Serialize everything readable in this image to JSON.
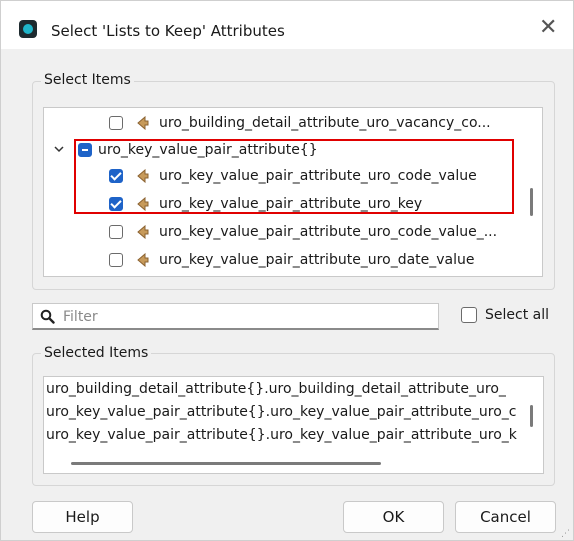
{
  "window": {
    "title": "Select 'Lists to Keep' Attributes",
    "close_glyph": "✕"
  },
  "select_items": {
    "group_label": "Select Items",
    "tree": [
      {
        "label": "uro_building_detail_attribute_uro_vacancy_co...",
        "checked": false,
        "kind": "attribute"
      },
      {
        "label": "uro_key_value_pair_attribute{}",
        "checked": "partial",
        "kind": "list",
        "expanded": true
      },
      {
        "label": "uro_key_value_pair_attribute_uro_code_value",
        "checked": true,
        "kind": "attribute"
      },
      {
        "label": "uro_key_value_pair_attribute_uro_key",
        "checked": true,
        "kind": "attribute"
      },
      {
        "label": "uro_key_value_pair_attribute_uro_code_value_...",
        "checked": false,
        "kind": "attribute"
      },
      {
        "label": "uro_key_value_pair_attribute_uro_date_value",
        "checked": false,
        "kind": "attribute"
      }
    ]
  },
  "filter": {
    "placeholder": "Filter"
  },
  "select_all": {
    "label": "Select all",
    "checked": false
  },
  "selected_items": {
    "group_label": "Selected Items",
    "lines": [
      "uro_building_detail_attribute{}.uro_building_detail_attribute_uro_",
      "uro_key_value_pair_attribute{}.uro_key_value_pair_attribute_uro_c",
      "uro_key_value_pair_attribute{}.uro_key_value_pair_attribute_uro_k"
    ]
  },
  "buttons": {
    "help": "Help",
    "ok": "OK",
    "cancel": "Cancel"
  },
  "colors": {
    "accent": "#1e63c8",
    "highlight_box": "#e00000",
    "attribute_icon": "#c79a5a"
  },
  "icons": {
    "app": "fme-app-icon",
    "close": "close-icon",
    "expand": "chevron-down-icon",
    "attribute": "attribute-arrow-icon",
    "search": "search-icon"
  }
}
